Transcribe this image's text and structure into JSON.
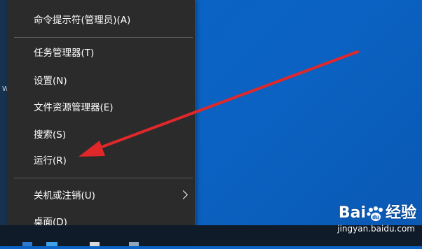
{
  "context_menu": {
    "items": [
      {
        "label": "命令提示符(管理员)(A)"
      },
      {
        "label": "任务管理器(T)"
      },
      {
        "label": "设置(N)"
      },
      {
        "label": "文件资源管理器(E)"
      },
      {
        "label": "搜索(S)"
      },
      {
        "label": "运行(R)"
      },
      {
        "label": "关机或注销(U)",
        "has_submenu": true
      },
      {
        "label": "桌面(D)"
      }
    ]
  },
  "watermark": {
    "brand_left": "Bai",
    "brand_right": "经验",
    "url": "jingyan.baidu.com"
  },
  "left_edge_mark": "W",
  "colors": {
    "menu_bg": "#2b2b2b",
    "desktop_bg": "#0b63c5",
    "annotation_arrow": "#e0282a",
    "taskbar": "#101b2a"
  },
  "annotation": {
    "type": "arrow",
    "points_to": "运行(R)"
  }
}
